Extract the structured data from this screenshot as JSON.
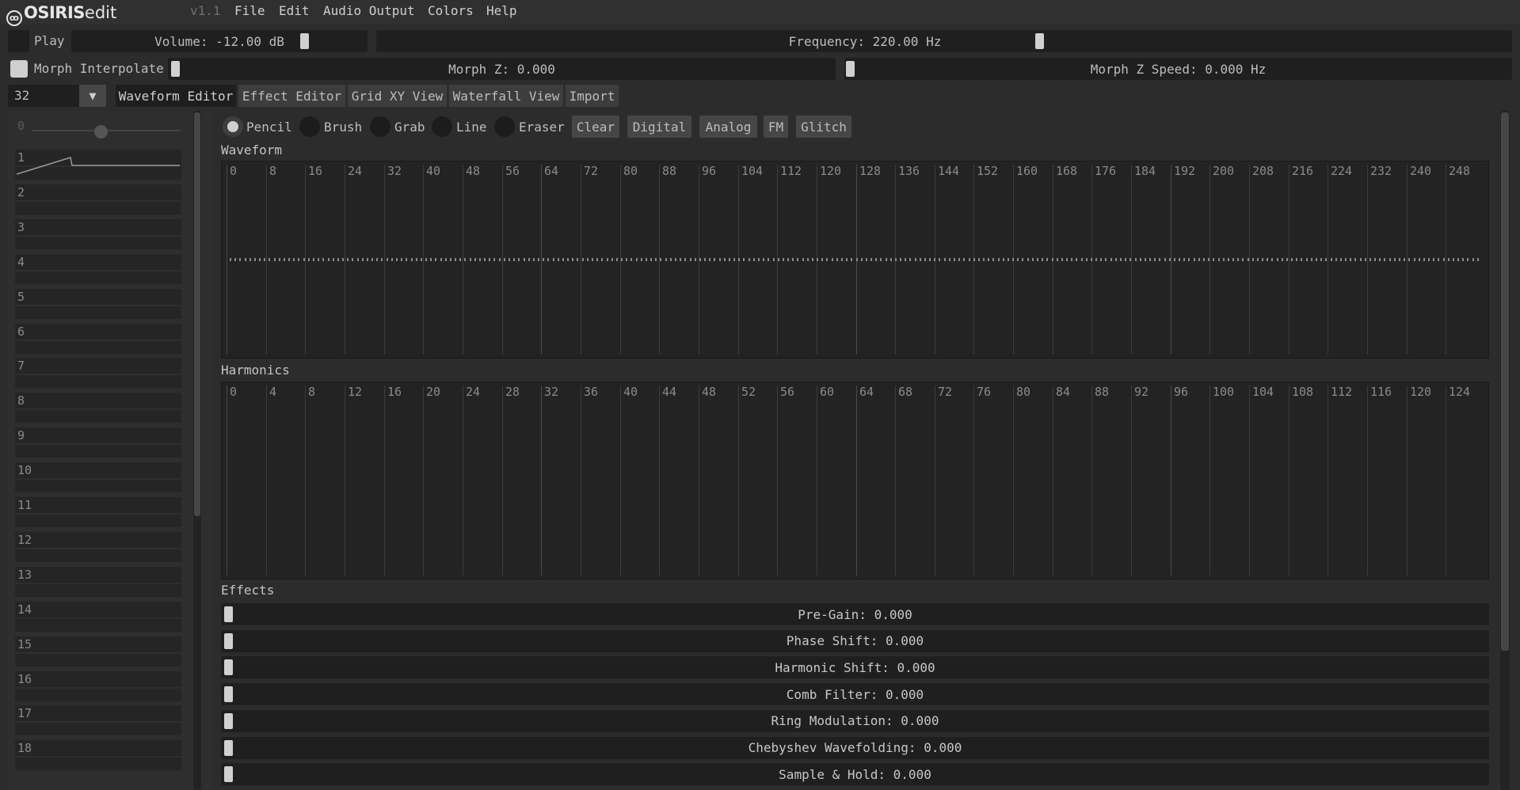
{
  "app": {
    "logo_bold": "OSIRIS",
    "logo_light": "edit",
    "version": "v1.1"
  },
  "menu": [
    "File",
    "Edit",
    "Audio Output",
    "Colors",
    "Help"
  ],
  "controls": {
    "play_label": "Play",
    "volume_label": "Volume: -12.00 dB",
    "frequency_label": "Frequency: 220.00 Hz",
    "morph_interpolate_label": "Morph Interpolate",
    "morph_z_label": "Morph Z: 0.000",
    "morph_z_speed_label": "Morph Z Speed: 0.000 Hz",
    "wavetable_size": "32",
    "dropdown_glyph": "▼"
  },
  "tabs": [
    "Waveform Editor",
    "Effect Editor",
    "Grid XY View",
    "Waterfall View",
    "Import"
  ],
  "active_tab": "Waveform Editor",
  "tools": {
    "radios": [
      "Pencil",
      "Brush",
      "Grab",
      "Line",
      "Eraser"
    ],
    "selected": "Pencil",
    "buttons": [
      "Clear",
      "Digital",
      "Analog",
      "FM",
      "Glitch"
    ]
  },
  "sidebar": {
    "slider_value": "0",
    "rows": [
      "1",
      "2",
      "3",
      "4",
      "5",
      "6",
      "7",
      "8",
      "9",
      "10",
      "11",
      "12",
      "13",
      "14",
      "15",
      "16",
      "17",
      "18"
    ]
  },
  "waveform": {
    "label": "Waveform",
    "ticks": [
      "0",
      "8",
      "16",
      "24",
      "32",
      "40",
      "48",
      "56",
      "64",
      "72",
      "80",
      "88",
      "96",
      "104",
      "112",
      "120",
      "128",
      "136",
      "144",
      "152",
      "160",
      "168",
      "176",
      "184",
      "192",
      "200",
      "208",
      "216",
      "224",
      "232",
      "240",
      "248"
    ]
  },
  "harmonics": {
    "label": "Harmonics",
    "ticks": [
      "0",
      "4",
      "8",
      "12",
      "16",
      "20",
      "24",
      "28",
      "32",
      "36",
      "40",
      "44",
      "48",
      "52",
      "56",
      "60",
      "64",
      "68",
      "72",
      "76",
      "80",
      "84",
      "88",
      "92",
      "96",
      "100",
      "104",
      "108",
      "112",
      "116",
      "120",
      "124"
    ]
  },
  "effects": {
    "label": "Effects",
    "items": [
      "Pre-Gain: 0.000",
      "Phase Shift: 0.000",
      "Harmonic Shift: 0.000",
      "Comb Filter: 0.000",
      "Ring Modulation: 0.000",
      "Chebyshev Wavefolding: 0.000",
      "Sample & Hold: 0.000"
    ]
  },
  "colors": {
    "background": "#2c2c2c",
    "panel": "#1f1f1f",
    "handle": "#d0d0d0",
    "text": "#bdbdbd"
  }
}
